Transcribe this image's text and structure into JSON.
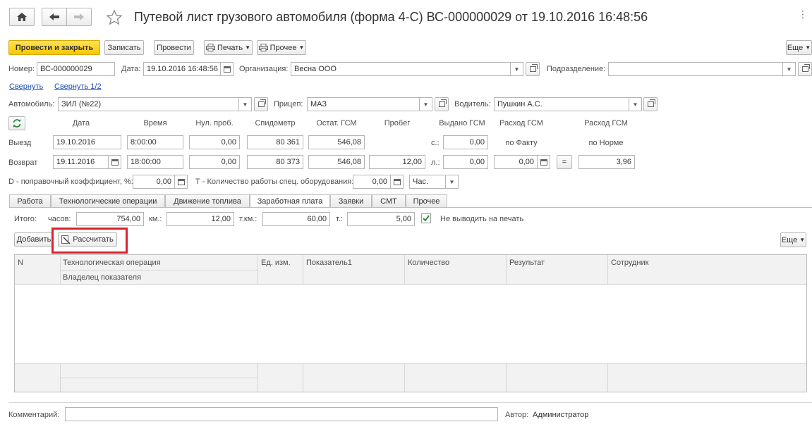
{
  "window": {
    "title": "Путевой лист грузового автомобиля (форма 4-С) ВС-000000029 от 19.10.2016 16:48:56"
  },
  "toolbar": {
    "post_close": "Провести и закрыть",
    "save": "Записать",
    "post": "Провести",
    "print": "Печать",
    "other": "Прочее",
    "more": "Еще"
  },
  "header": {
    "number_label": "Номер:",
    "number": "ВС-000000029",
    "date_label": "Дата:",
    "date": "19.10.2016 16:48:56",
    "org_label": "Организация:",
    "org": "Весна ООО",
    "division_label": "Подразделение:",
    "division": "",
    "collapse": "Свернуть",
    "collapse_half": "Свернуть 1/2",
    "vehicle_label": "Автомобиль:",
    "vehicle": "ЗИЛ (№22)",
    "trailer_label": "Прицеп:",
    "trailer": "МАЗ",
    "driver_label": "Водитель:",
    "driver": "Пушкин А.С."
  },
  "trip": {
    "col_date": "Дата",
    "col_time": "Время",
    "col_zero": "Нул. проб.",
    "col_odo": "Спидометр",
    "col_fuel": "Остат. ГСМ",
    "col_mileage": "Пробег",
    "col_issued": "Выдано ГСМ",
    "col_fact": "Расход ГСМ",
    "col_norm": "Расход ГСМ",
    "fact_sub": "по Факту",
    "norm_sub": "по Норме",
    "depart_label": "Выезд",
    "depart_date": "19.10.2016",
    "depart_time": "8:00:00",
    "depart_zero": "0,00",
    "depart_odo": "80 361",
    "depart_fuel": "546,08",
    "issued_s_label": "с.:",
    "issued_s": "0,00",
    "return_label": "Возврат",
    "return_date": "19.11.2016",
    "return_time": "18:00:00",
    "return_zero": "0,00",
    "return_odo": "80 373",
    "return_fuel": "546,08",
    "mileage": "12,00",
    "issued_l_label": "л.:",
    "issued_l": "0,00",
    "fact": "0,00",
    "eq": "=",
    "norm": "3,96",
    "d_label": "D - поправочный коэффициент, %:",
    "d_value": "0,00",
    "t_label": "Т - Количество работы спец. оборудования:",
    "t_value": "0,00",
    "t_unit": "Час."
  },
  "tabs": [
    "Работа",
    "Технологические операции",
    "Движение топлива",
    "Заработная плата",
    "Заявки",
    "СМТ",
    "Прочее"
  ],
  "totals": {
    "label": "Итого:",
    "hours_label": "часов:",
    "hours": "754,00",
    "km_label": "км.:",
    "km": "12,00",
    "tkm_label": "т.км.:",
    "tkm": "60,00",
    "t_label": "т.:",
    "t": "5,00",
    "no_print": "Не выводить на печать"
  },
  "table_toolbar": {
    "add": "Добавить",
    "calculate": "Рассчитать",
    "more": "Еще"
  },
  "table": {
    "col_n": "N",
    "col_op": "Технологическая операция",
    "col_owner": "Владелец показателя",
    "col_unit": "Ед. изм.",
    "col_ind": "Показатель1",
    "col_qty": "Количество",
    "col_result": "Результат",
    "col_employee": "Сотрудник"
  },
  "footer": {
    "comment_label": "Комментарий:",
    "comment": "",
    "author_label": "Автор:",
    "author": "Администратор"
  },
  "colors": {
    "primary_button": "#f6c800",
    "highlight_frame": "#d9232e",
    "link": "#1f4fb0",
    "checkbox_check": "#2e8b3a"
  }
}
